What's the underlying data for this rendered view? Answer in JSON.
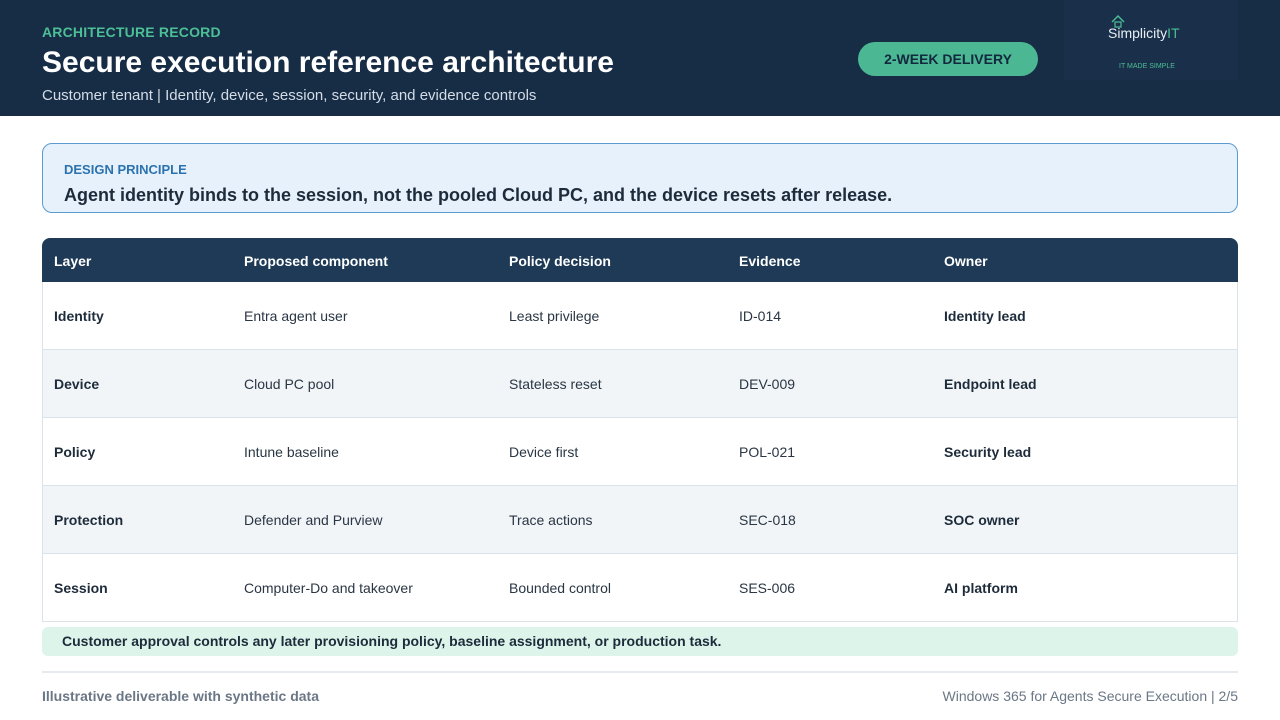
{
  "header": {
    "eyebrow": "ARCHITECTURE RECORD",
    "title": "Secure execution reference architecture",
    "subtitle": "Customer tenant | Identity, device, session, security, and evidence controls",
    "badge": "2-WEEK DELIVERY",
    "logo": {
      "name_main": "Simplicity",
      "name_accent": "IT",
      "tagline": "IT MADE SIMPLE",
      "icon": "cloud-house-icon"
    }
  },
  "principle": {
    "label": "DESIGN PRINCIPLE",
    "text": "Agent identity binds to the session, not the pooled Cloud PC, and the device resets after release."
  },
  "table": {
    "headers": [
      "Layer",
      "Proposed component",
      "Policy decision",
      "Evidence",
      "Owner"
    ],
    "rows": [
      [
        "Identity",
        "Entra agent user",
        "Least privilege",
        "ID-014",
        "Identity lead"
      ],
      [
        "Device",
        "Cloud PC pool",
        "Stateless reset",
        "DEV-009",
        "Endpoint lead"
      ],
      [
        "Policy",
        "Intune baseline",
        "Device first",
        "POL-021",
        "Security lead"
      ],
      [
        "Protection",
        "Defender and Purview",
        "Trace actions",
        "SEC-018",
        "SOC owner"
      ],
      [
        "Session",
        "Computer-Do and takeover",
        "Bounded control",
        "SES-006",
        "AI platform"
      ]
    ]
  },
  "note": "Customer approval controls any later provisioning policy, baseline assignment, or production task.",
  "footer": {
    "left": "Illustrative deliverable with synthetic data",
    "right": "Windows 365 for Agents Secure Execution | 2/5"
  },
  "colors": {
    "navy": "#172c45",
    "accent": "#4cb893",
    "principle_bg": "#e7f1fb",
    "note_bg": "#dcf4ea"
  }
}
